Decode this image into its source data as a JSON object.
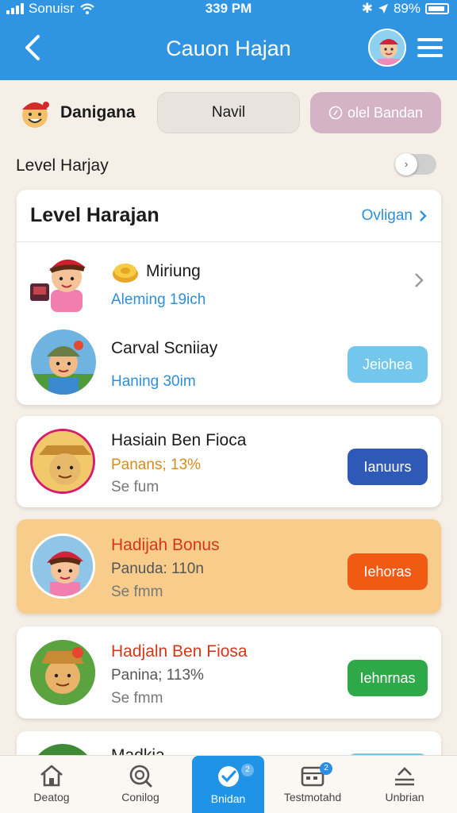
{
  "status_bar": {
    "carrier": "Sonuisr",
    "time": "339 PM",
    "battery": "89%"
  },
  "header": {
    "title": "Cauon Hajan"
  },
  "filters": {
    "user_name": "Danigana",
    "pill_1": "Navil",
    "pill_2": "olel Bandan"
  },
  "level_toggle": {
    "label": "Level Harjay"
  },
  "level_card": {
    "title": "Level Harajan",
    "link": "Ovligan",
    "rows": [
      {
        "title": "Miriung",
        "subtitle": "Aleming 19ich"
      },
      {
        "title": "Carval Scniiay",
        "subtitle": "Haning 30im",
        "action": "Jeiohea"
      }
    ]
  },
  "cards": [
    {
      "title": "Hasiain Ben Fioca",
      "subtitle": "Panans; 13%",
      "meta": "Se fum",
      "action": "Ianuurs"
    },
    {
      "title": "Hadijah Bonus",
      "subtitle": "Panuda: 110n",
      "meta": "Se fmm",
      "action": "Iehoras"
    },
    {
      "title": "Hadjaln Ben Fiosa",
      "subtitle": "Panina; 113%",
      "meta": "Se fmm",
      "action": "Iehnrnas"
    },
    {
      "title": "Madkia"
    }
  ],
  "bottom_nav": [
    {
      "label": "Deatog"
    },
    {
      "label": "Conilog"
    },
    {
      "label": "Bnidan",
      "badge": "2"
    },
    {
      "label": "Testmotahd",
      "badge": "2"
    },
    {
      "label": "Unbrian"
    }
  ],
  "colors": {
    "header": "#2f95e3",
    "action_light_blue": "#74c7ec",
    "action_navy": "#2f59b6",
    "action_orange": "#f05a12",
    "action_green": "#2fa84a",
    "highlight_card": "#f8cd8c"
  }
}
